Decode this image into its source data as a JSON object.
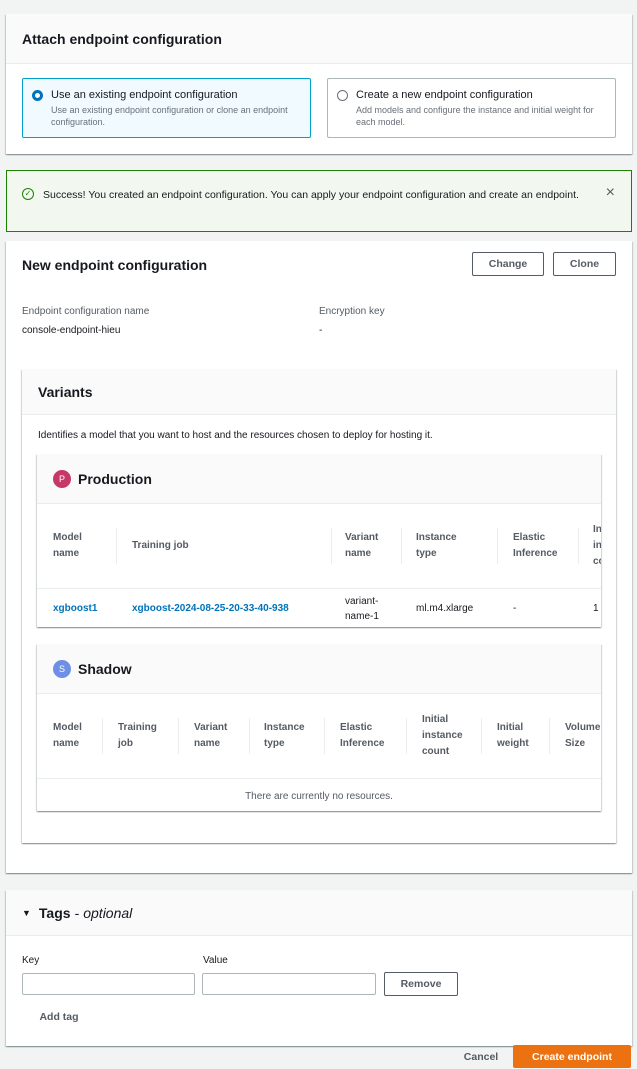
{
  "attach": {
    "title": "Attach endpoint configuration",
    "options": [
      {
        "title": "Use an existing endpoint configuration",
        "desc": "Use an existing endpoint configuration or clone an endpoint configuration."
      },
      {
        "title": "Create a new endpoint configuration",
        "desc": "Add models and configure the instance and initial weight for each model."
      }
    ]
  },
  "alert": {
    "message": "Success! You created an endpoint configuration. You can apply your endpoint configuration and create an endpoint.",
    "close_icon": "×"
  },
  "config": {
    "title": "New endpoint configuration",
    "change_label": "Change",
    "clone_label": "Clone",
    "name_label": "Endpoint configuration name",
    "name_value": "console-endpoint-hieu",
    "key_label": "Encryption key",
    "key_value": "-"
  },
  "variants": {
    "title": "Variants",
    "description": "Identifies a model that you want to host and the resources chosen to deploy for hosting it.",
    "production": {
      "badge": "P",
      "title": "Production",
      "columns": [
        "Model name",
        "Training job",
        "Variant name",
        "Instance type",
        "Elastic Inference",
        "Initial instance count"
      ],
      "col_partial": [
        "In",
        "in",
        "cc"
      ],
      "row": {
        "model": "xgboost1",
        "job": "xgboost-2024-08-25-20-33-40-938",
        "variant": "variant-name-1",
        "instance": "ml.m4.xlarge",
        "elastic": "-",
        "count": "1"
      }
    },
    "shadow": {
      "badge": "S",
      "title": "Shadow",
      "columns": [
        "Model name",
        "Training job",
        "Variant name",
        "Instance type",
        "Elastic Inference",
        "Initial instance count",
        "Initial weight",
        "Volume Size"
      ],
      "empty": "There are currently no resources."
    }
  },
  "tags": {
    "title": "Tags",
    "optional": "optional",
    "key_label": "Key",
    "value_label": "Value",
    "remove_label": "Remove",
    "add_label": "Add tag"
  },
  "footer": {
    "cancel_label": "Cancel",
    "create_label": "Create endpoint"
  }
}
